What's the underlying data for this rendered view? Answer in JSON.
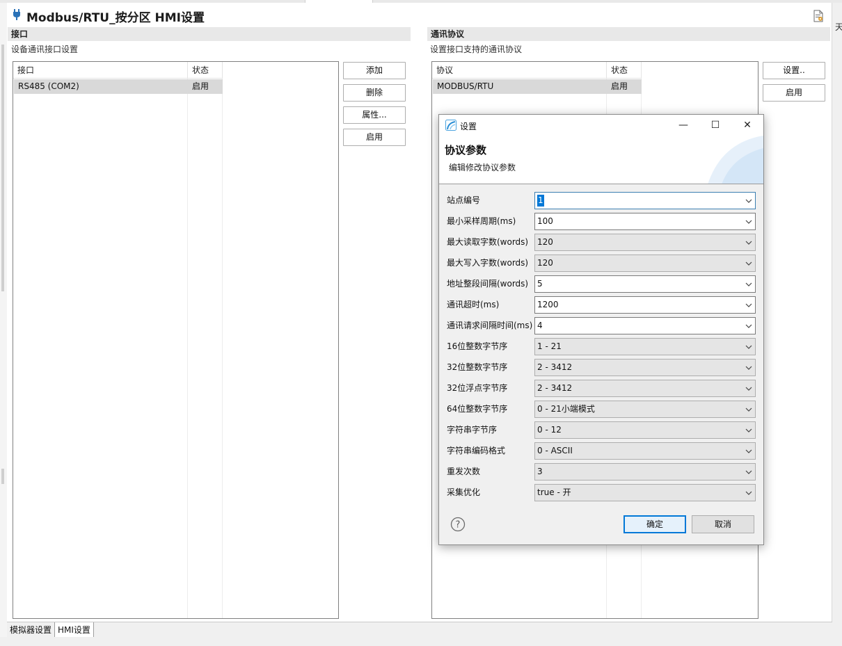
{
  "editor": {
    "title": "Modbus/RTU_按分区 HMI设置",
    "right_cut_text": "天"
  },
  "interface_section": {
    "header": "接口",
    "desc": "设备通讯接口设置",
    "columns": [
      "接口",
      "状态"
    ],
    "rows": [
      {
        "name": "RS485 (COM2)",
        "status": "启用"
      }
    ],
    "buttons": {
      "add": "添加",
      "delete": "删除",
      "props": "属性...",
      "enable": "启用"
    }
  },
  "protocol_section": {
    "header": "通讯协议",
    "desc": "设置接口支持的通讯协议",
    "columns": [
      "协议",
      "状态"
    ],
    "rows": [
      {
        "name": "MODBUS/RTU",
        "status": "启用"
      }
    ],
    "buttons": {
      "settings": "设置..",
      "enable": "启用"
    }
  },
  "dialog": {
    "title": "设置",
    "minimize": "—",
    "maximize": "☐",
    "close": "✕",
    "heading": "协议参数",
    "subheading": "编辑修改协议参数",
    "fields": [
      {
        "label": "站点编号",
        "value": "1"
      },
      {
        "label": "最小采样周期(ms)",
        "value": "100"
      },
      {
        "label": "最大读取字数(words)",
        "value": "120"
      },
      {
        "label": "最大写入字数(words)",
        "value": "120"
      },
      {
        "label": "地址整段间隔(words)",
        "value": "5"
      },
      {
        "label": "通讯超时(ms)",
        "value": "1200"
      },
      {
        "label": "通讯请求间隔时间(ms)",
        "value": "4"
      },
      {
        "label": "16位整数字节序",
        "value": "1 - 21"
      },
      {
        "label": "32位整数字节序",
        "value": "2 - 3412"
      },
      {
        "label": "32位浮点字节序",
        "value": "2 - 3412"
      },
      {
        "label": "64位整数字节序",
        "value": "0 - 21小端模式"
      },
      {
        "label": "字符串字节序",
        "value": "0 - 12"
      },
      {
        "label": "字符串编码格式",
        "value": "0 - ASCII"
      },
      {
        "label": "重发次数",
        "value": "3"
      },
      {
        "label": "采集优化",
        "value": "true - 开"
      }
    ],
    "ok": "确定",
    "cancel": "取消",
    "help": "?"
  },
  "bottom_tabs": [
    {
      "label": "模拟器设置"
    },
    {
      "label": "HMI设置"
    }
  ],
  "colors": {
    "accent": "#0078d7",
    "selected_row": "#d9d9d9",
    "section_bar": "#e8e8e8"
  }
}
